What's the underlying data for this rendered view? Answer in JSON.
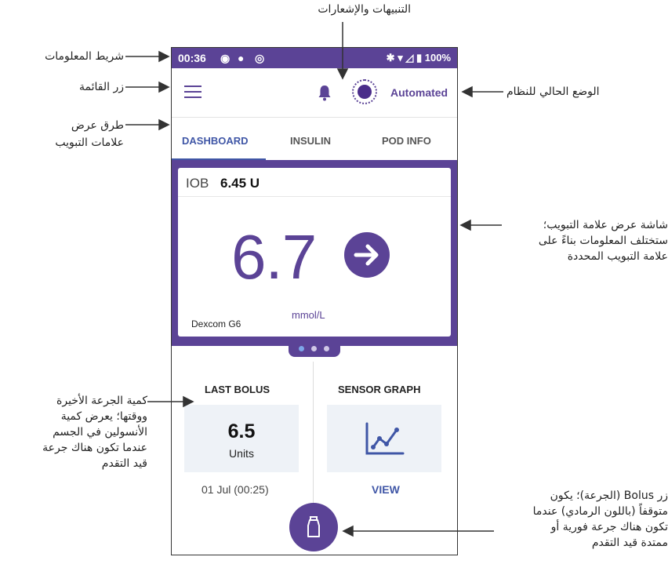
{
  "status_bar": {
    "time": "00:36",
    "battery": "100%"
  },
  "app_bar": {
    "mode_label": "Automated"
  },
  "tabs": [
    {
      "label": "DASHBOARD",
      "active": true
    },
    {
      "label": "INSULIN",
      "active": false
    },
    {
      "label": "POD INFO",
      "active": false
    }
  ],
  "dashboard": {
    "iob_label": "IOB",
    "iob_value": "6.45 U",
    "glucose_value": "6.7",
    "glucose_unit": "mmol/L",
    "sensor_name": "Dexcom G6",
    "page_count": 3,
    "page_active": 1
  },
  "last_bolus": {
    "title": "LAST BOLUS",
    "value": "6.5",
    "unit": "Units",
    "time": "01 Jul (00:25)"
  },
  "sensor_graph": {
    "title": "SENSOR GRAPH",
    "action": "VIEW"
  },
  "callouts": {
    "notifications": "التنبيهات والإشعارات",
    "status_bar": "شريط المعلومات",
    "menu_button": "زر القائمة",
    "tab_views_1": "طرق عرض",
    "tab_views_2": "علامات التبويب",
    "current_mode": "الوضع الحالي للنظام",
    "tab_screen_1": "شاشة عرض علامة التبويب؛",
    "tab_screen_2": "ستختلف المعلومات بناءً على",
    "tab_screen_3": "علامة التبويب المحددة",
    "last_bolus_1": "كمية الجرعة الأخيرة",
    "last_bolus_2": "ووقتها؛ يعرض كمية",
    "last_bolus_3": "الأنسولين في الجسم",
    "last_bolus_4": "عندما تكون هناك جرعة",
    "last_bolus_5": "قيد التقدم",
    "bolus_button_1": "زر Bolus (الجرعة)؛ يكون",
    "bolus_button_2": "متوقفاً (باللون الرمادي) عندما",
    "bolus_button_3": "تكون هناك جرعة فورية أو",
    "bolus_button_4": "ممتدة قيد التقدم"
  },
  "colors": {
    "brand_purple": "#5b4396",
    "tab_blue": "#3f56a6"
  }
}
